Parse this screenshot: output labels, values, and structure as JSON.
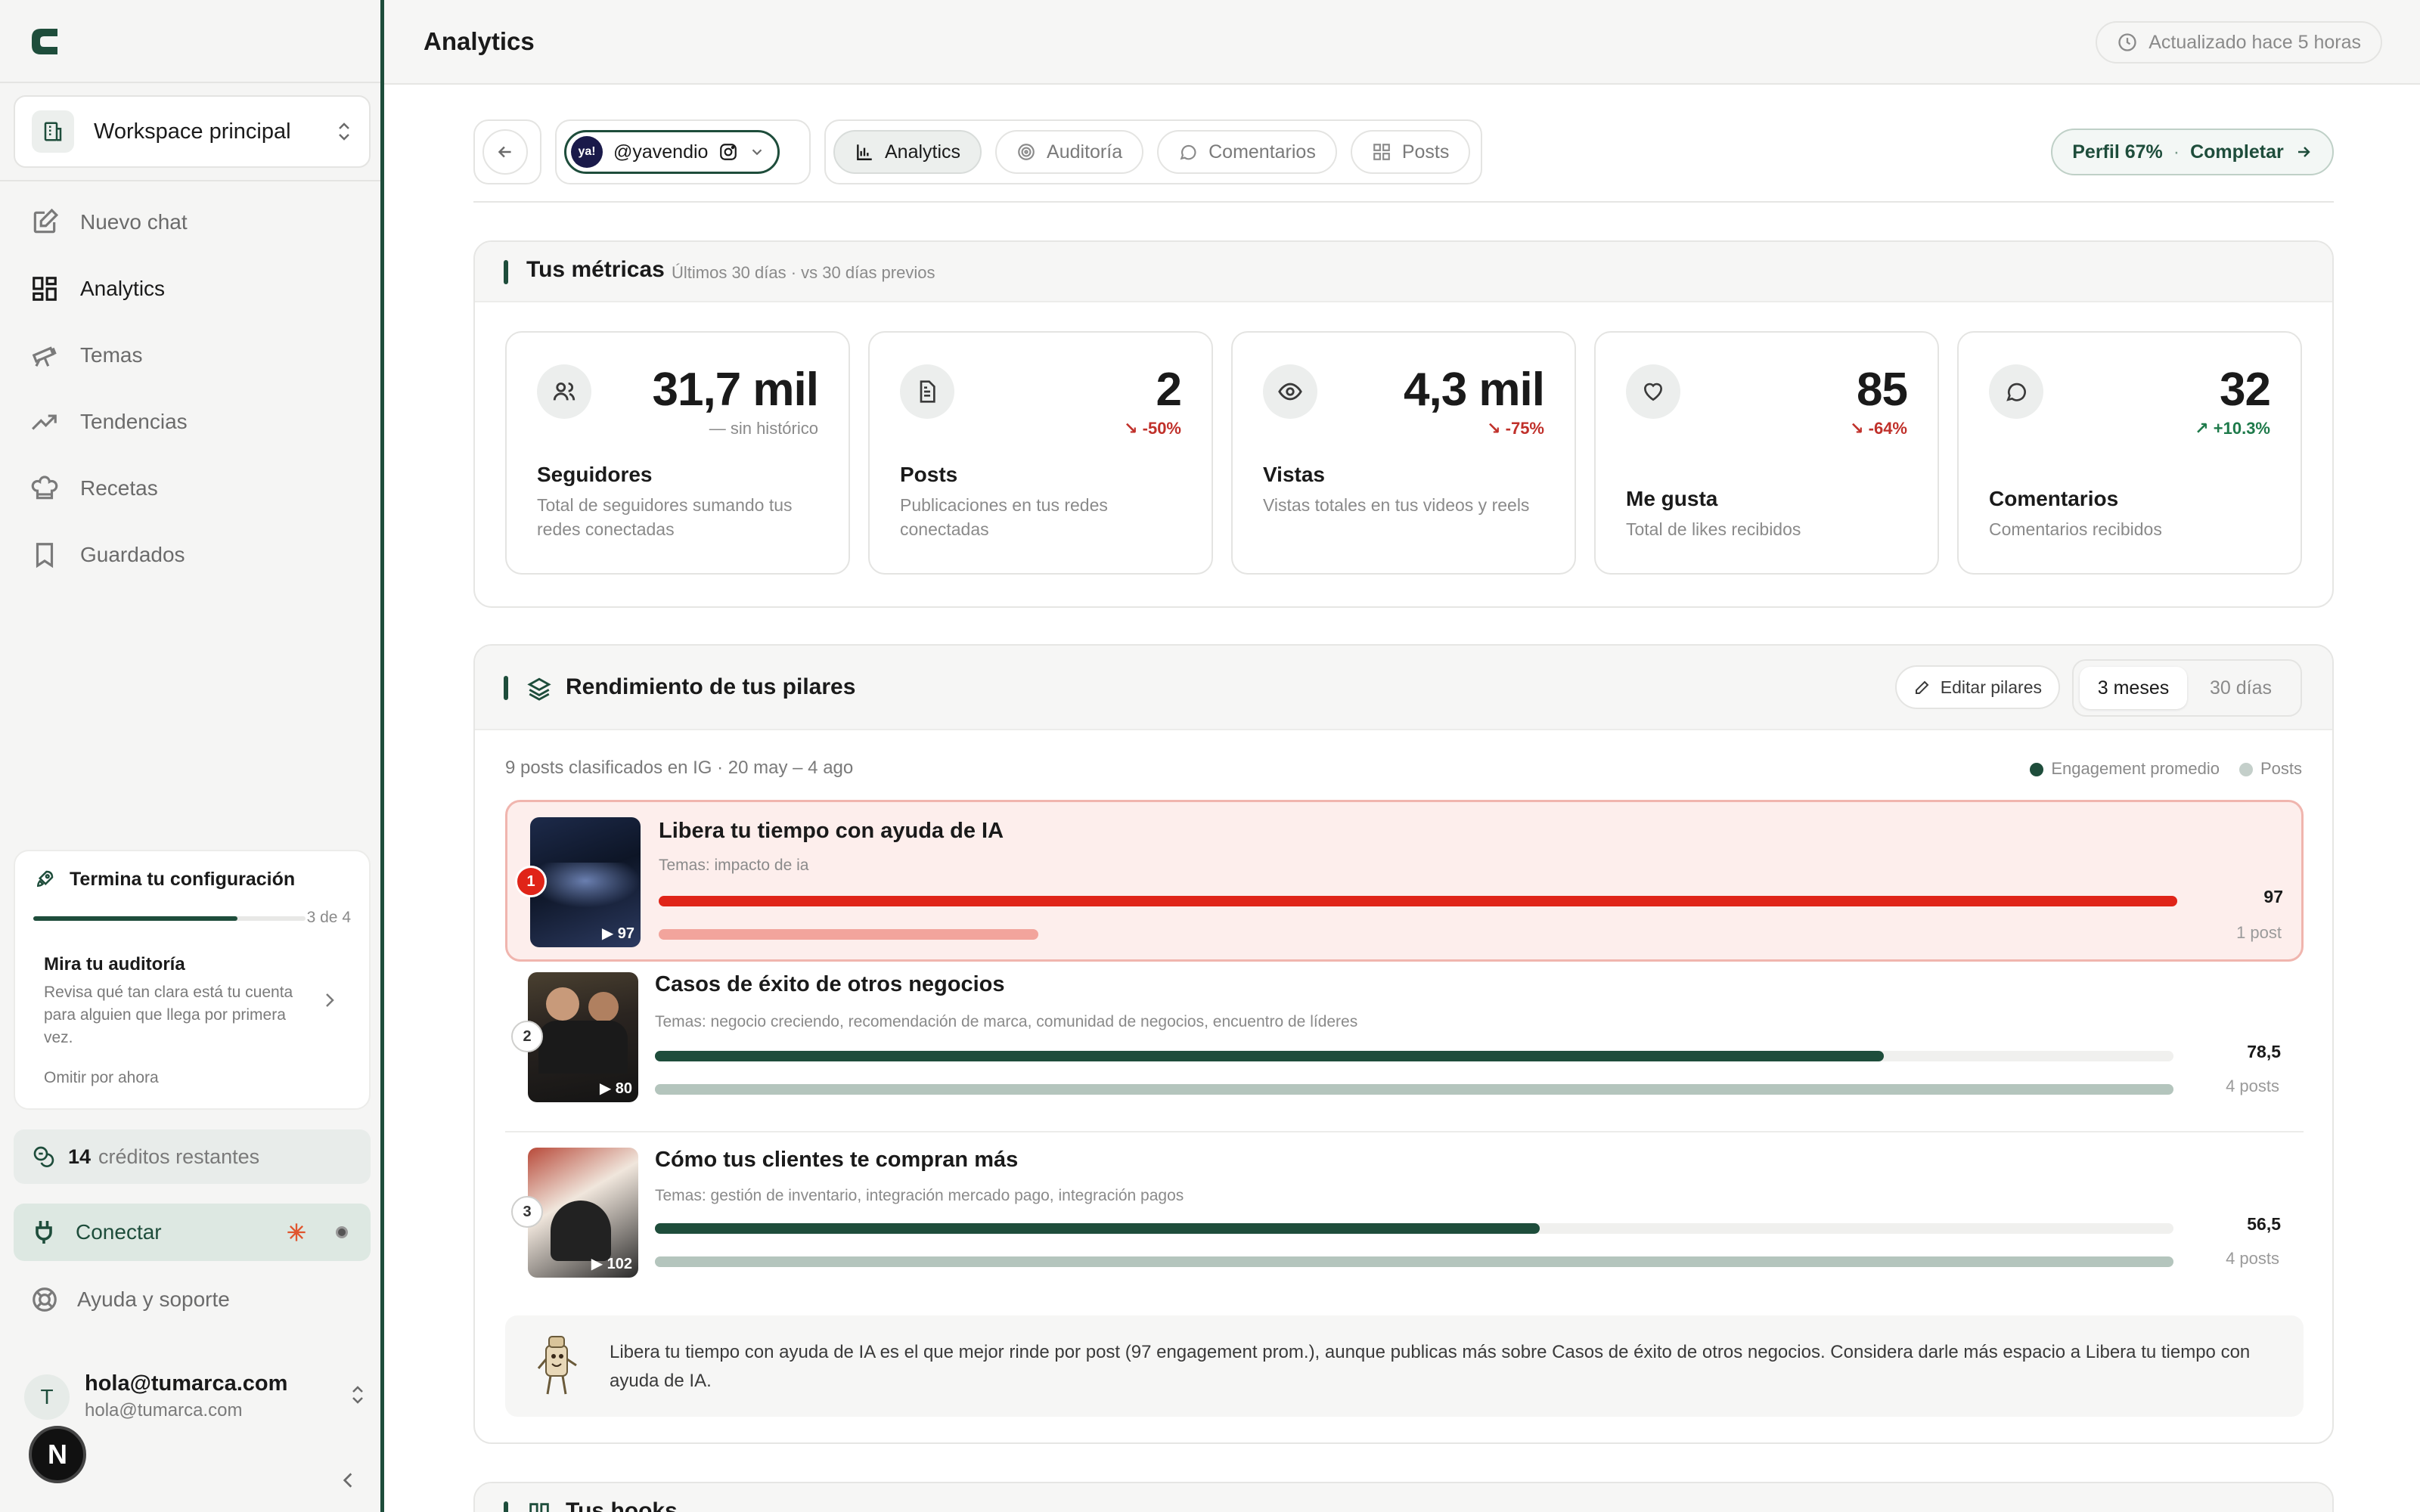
{
  "app": {
    "title": "Analytics",
    "updated": "Actualizado hace 5 horas"
  },
  "sidebar": {
    "workspace": "Workspace principal",
    "items": [
      {
        "label": "Nuevo chat",
        "icon": "edit-icon"
      },
      {
        "label": "Analytics",
        "icon": "grid-icon"
      },
      {
        "label": "Temas",
        "icon": "telescope-icon"
      },
      {
        "label": "Tendencias",
        "icon": "trending-icon"
      },
      {
        "label": "Recetas",
        "icon": "chef-hat-icon"
      },
      {
        "label": "Guardados",
        "icon": "bookmark-icon"
      }
    ],
    "setup": {
      "title": "Termina tu configuración",
      "count": "3 de 4",
      "progress": 0.75,
      "card_title": "Mira tu auditoría",
      "card_desc": "Revisa qué tan clara está tu cuenta para alguien que llega por primera vez.",
      "skip": "Omitir por ahora"
    },
    "credits_count": "14",
    "credits_label": "créditos restantes",
    "connect": "Conectar",
    "help": "Ayuda y soporte",
    "user_initial": "T",
    "user_name": "hola@tumarca.com",
    "user_email": "hola@tumarca.com",
    "badge": "N"
  },
  "toolbar": {
    "account": "@yavendio",
    "account_logo": "ya!",
    "tabs": [
      {
        "label": "Analytics",
        "icon": "bar-chart-icon"
      },
      {
        "label": "Auditoría",
        "icon": "target-icon"
      },
      {
        "label": "Comentarios",
        "icon": "comment-icon"
      },
      {
        "label": "Posts",
        "icon": "grid-icon"
      }
    ],
    "profile_pct": "Perfil 67%",
    "profile_sep": "·",
    "profile_action": "Completar"
  },
  "metrics": {
    "title": "Tus métricas",
    "subtitle": "Últimos 30 días · vs 30 días previos",
    "cards": [
      {
        "value": "31,7 mil",
        "delta": "— sin histórico",
        "name": "Seguidores",
        "desc": "Total de seguidores sumando tus redes conectadas",
        "icon": "users-icon"
      },
      {
        "value": "2",
        "delta": "↘ -50%",
        "name": "Posts",
        "desc": "Publicaciones en tus redes conectadas",
        "icon": "document-icon"
      },
      {
        "value": "4,3 mil",
        "delta": "↘ -75%",
        "name": "Vistas",
        "desc": "Vistas totales en tus videos y reels",
        "icon": "eye-icon"
      },
      {
        "value": "85",
        "delta": "↘ -64%",
        "name": "Me gusta",
        "desc": "Total de likes recibidos",
        "icon": "heart-icon"
      },
      {
        "value": "32",
        "delta": "↗ +10.3%",
        "name": "Comentarios",
        "desc": "Comentarios recibidos",
        "icon": "comment-icon"
      }
    ]
  },
  "pillars": {
    "title": "Rendimiento de tus pilares",
    "edit": "Editar pilares",
    "range_options": [
      "3 meses",
      "30 días"
    ],
    "meta": "9 posts clasificados en IG · 20 may – 4 ago",
    "legend": [
      "Engagement promedio",
      "Posts"
    ],
    "max_engagement": 97,
    "max_posts": 4,
    "colors": {
      "top_bar": "#e02418",
      "top_posts": "#f2a49c",
      "bar": "#1e4d3b",
      "posts": "#b4c5bd"
    },
    "items": [
      {
        "rank": "1",
        "title": "Libera tu tiempo con ayuda de IA",
        "topics": "Temas: impacto de ia",
        "score": "97",
        "engagement": 97,
        "posts_label": "1 post",
        "posts": 1,
        "thumb_views": "▶ 97"
      },
      {
        "rank": "2",
        "title": "Casos de éxito de otros negocios",
        "topics": "Temas: negocio creciendo, recomendación de marca, comunidad de negocios, encuentro de líderes",
        "score": "78,5",
        "engagement": 78.5,
        "posts_label": "4 posts",
        "posts": 4,
        "thumb_views": "▶ 80"
      },
      {
        "rank": "3",
        "title": "Cómo tus clientes te compran más",
        "topics": "Temas: gestión de inventario, integración mercado pago, integración pagos",
        "score": "56,5",
        "engagement": 56.5,
        "posts_label": "4 posts",
        "posts": 4,
        "thumb_views": "▶ 102"
      }
    ],
    "insight": "Libera tu tiempo con ayuda de IA es el que mejor rinde por post (97 engagement prom.), aunque publicas más sobre Casos de éxito de otros negocios. Considera darle más espacio a Libera tu tiempo con ayuda de IA."
  },
  "hooks": {
    "title": "Tus hooks"
  }
}
